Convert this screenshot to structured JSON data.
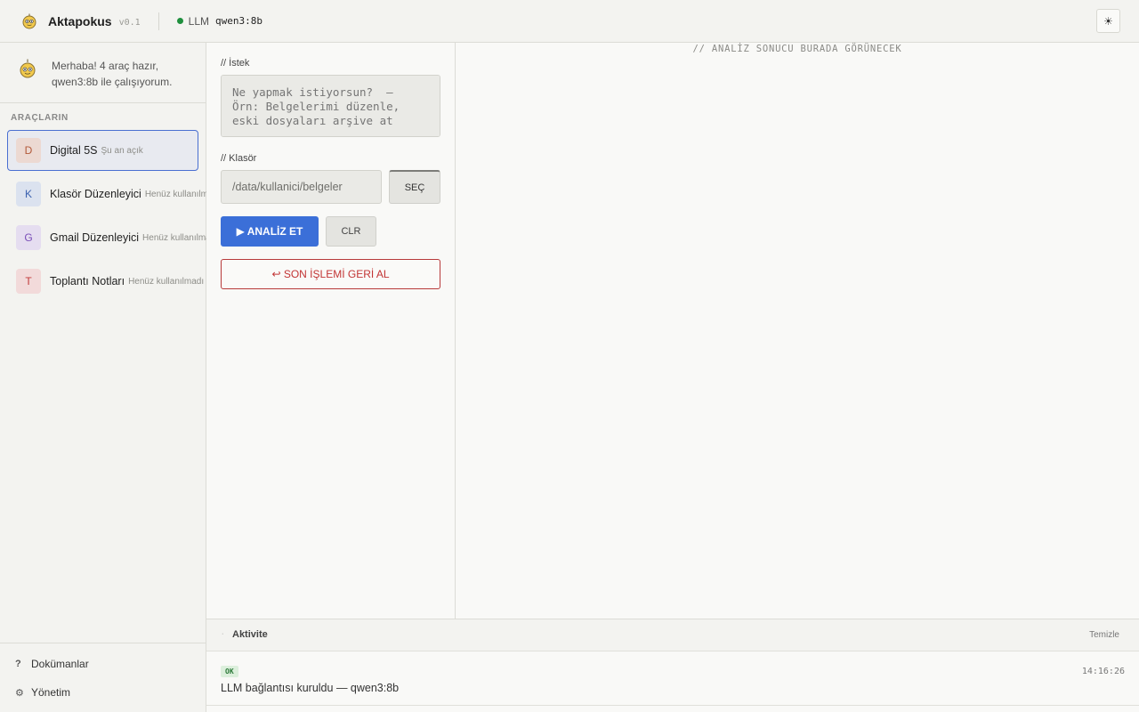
{
  "app": {
    "name": "Aktapokus",
    "version": "v0.1",
    "llm_label": "LLM",
    "llm_model": "qwen3:8b",
    "llm_status_color": "#1e8f3d",
    "theme_toggle_icon": "sun-icon",
    "theme_toggle_glyph": "☀"
  },
  "sidebar": {
    "greeting": "Merhaba! 4 araç hazır, qwen3:8b ile çalışıyorum.",
    "tools_title": "ARAÇLARIN",
    "tools": [
      {
        "badge": "D",
        "name": "Digital 5S",
        "status": "Şu an açık",
        "active": true,
        "badge_bg": "#ecd9d2",
        "badge_color": "#b25a3a"
      },
      {
        "badge": "K",
        "name": "Klasör Düzenleyici",
        "status": "Henüz kullanılmadı",
        "active": false,
        "badge_bg": "#dbe2ef",
        "badge_color": "#3c62b0"
      },
      {
        "badge": "G",
        "name": "Gmail Düzenleyici",
        "status": "Henüz kullanılmadı",
        "active": false,
        "badge_bg": "#e5ddf0",
        "badge_color": "#7a4fb8"
      },
      {
        "badge": "T",
        "name": "Toplantı Notları",
        "status": "Henüz kullanılmadı",
        "active": false,
        "badge_bg": "#f2dada",
        "badge_color": "#c23a3a"
      }
    ],
    "footer": {
      "docs_icon": "?",
      "docs_label": "Dokümanlar",
      "admin_icon": "⚙",
      "admin_label": "Yönetim"
    }
  },
  "form": {
    "request_label": "// İstek",
    "request_placeholder": "Ne yapmak istiyorsun?  —  Örn: Belgelerimi düzenle, eski dosyaları arşive at",
    "folder_label": "// Klasör",
    "folder_placeholder": "/data/kullanici/belgeler",
    "pick_button": "SEÇ",
    "analyze_button": "▶ ANALİZ ET",
    "clear_button": "CLR",
    "undo_button": "↩ SON İŞLEMİ GERİ AL",
    "accent_color": "#3b6fd8",
    "danger_color": "#c23434"
  },
  "result": {
    "placeholder": "// ANALİZ SONUCU BURADA GÖRÜNECEK"
  },
  "activity": {
    "toggle_glyph": "·",
    "title": "Aktivite",
    "clear_label": "Temizle",
    "logs": [
      {
        "badge": "OK",
        "message": "LLM bağlantısı kuruldu — qwen3:8b",
        "time": "14:16:26"
      }
    ]
  }
}
